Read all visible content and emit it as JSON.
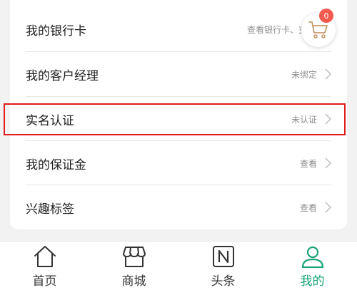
{
  "menu": [
    {
      "label": "我的银行卡",
      "value": "查看银行卡、支"
    },
    {
      "label": "我的客户经理",
      "value": "未绑定"
    },
    {
      "label": "实名认证",
      "value": "未认证"
    },
    {
      "label": "我的保证金",
      "value": "查看"
    },
    {
      "label": "兴趣标签",
      "value": "查看"
    }
  ],
  "cart": {
    "badge": "0"
  },
  "tabs": [
    {
      "label": "首页",
      "icon": "home-icon"
    },
    {
      "label": "商城",
      "icon": "store-icon"
    },
    {
      "label": "头条",
      "icon": "news-icon"
    },
    {
      "label": "我的",
      "icon": "person-icon",
      "active": true
    }
  ],
  "colors": {
    "accent": "#1aa37a",
    "highlight": "#e01b1b",
    "badge": "#f45a4d",
    "cart_icon": "#c49a6c"
  }
}
